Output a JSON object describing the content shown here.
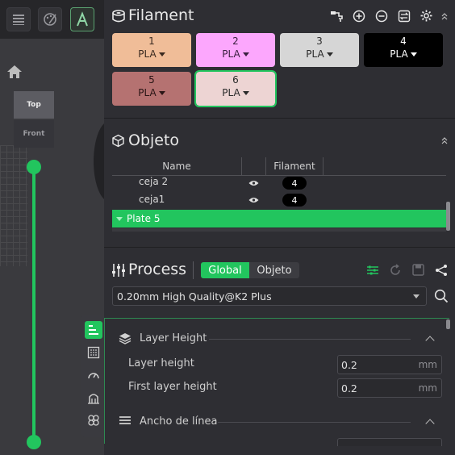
{
  "filament": {
    "title": "Filament",
    "slots": [
      {
        "num": "1",
        "type": "PLA",
        "color": "#f0bd98",
        "text_color": "#3a2a20"
      },
      {
        "num": "2",
        "type": "PLA",
        "color": "#fca7fd",
        "text_color": "#3a2040"
      },
      {
        "num": "3",
        "type": "PLA",
        "color": "#d6d6d6",
        "text_color": "#2a2a2a"
      },
      {
        "num": "4",
        "type": "PLA",
        "color": "#000000",
        "text_color": "#ffffff"
      },
      {
        "num": "5",
        "type": "PLA",
        "color": "#b57271",
        "text_color": "#2a1515"
      },
      {
        "num": "6",
        "type": "PLA",
        "color": "#edd4d3",
        "text_color": "#2a2a2a"
      }
    ]
  },
  "objeto": {
    "title": "Objeto",
    "columns": {
      "name": "Name",
      "filament": "Filament"
    },
    "rows": [
      {
        "name": "ceja 2",
        "filament": "4"
      },
      {
        "name": "ceja1",
        "filament": "4"
      }
    ],
    "plate": "Plate 5"
  },
  "process": {
    "title": "Process",
    "mode_global": "Global",
    "mode_objeto": "Objeto",
    "preset": "0.20mm High Quality@K2 Plus",
    "groups": {
      "layer_height": {
        "title": "Layer Height",
        "params": [
          {
            "label": "Layer height",
            "value": "0.2",
            "unit": "mm"
          },
          {
            "label": "First layer height",
            "value": "0.2",
            "unit": "mm"
          }
        ]
      },
      "line_width": {
        "title": "Ancho de línea"
      }
    }
  },
  "viewport": {
    "view_top": "Top",
    "view_front": "Front"
  },
  "colors": {
    "accent": "#22c55e"
  }
}
